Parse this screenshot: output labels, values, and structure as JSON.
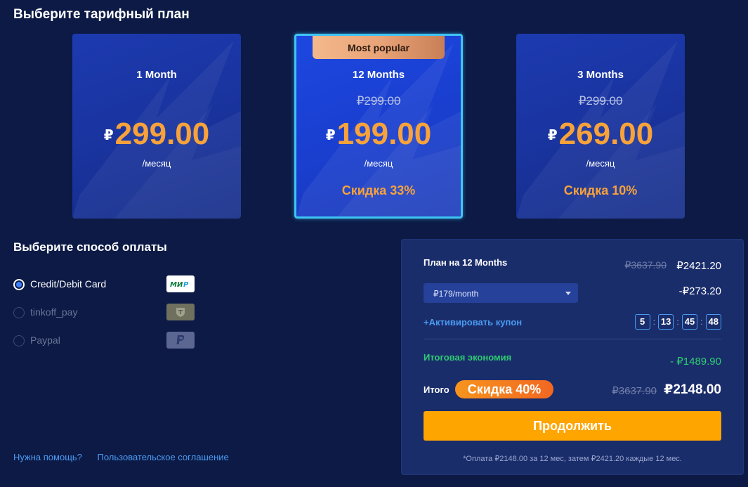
{
  "header": {
    "title": "Выберите тарифный план"
  },
  "plans": [
    {
      "name": "1 Month",
      "old_price": "",
      "currency": "₽",
      "price": "299.00",
      "per": "/месяц",
      "discount": ""
    },
    {
      "name": "12 Months",
      "badge": "Most popular",
      "old_price": "₽299.00",
      "currency": "₽",
      "price": "199.00",
      "per": "/месяц",
      "discount": "Скидка 33%"
    },
    {
      "name": "3 Months",
      "old_price": "₽299.00",
      "currency": "₽",
      "price": "269.00",
      "per": "/месяц",
      "discount": "Скидка 10%"
    }
  ],
  "payment": {
    "title": "Выберите способ оплаты",
    "methods": [
      {
        "label": "Credit/Debit Card",
        "logo": "мир",
        "selected": true
      },
      {
        "label": "tinkoff_pay",
        "selected": false
      },
      {
        "label": "Paypal",
        "selected": false
      }
    ]
  },
  "footer": {
    "help": "Нужна помощь?",
    "agreement": "Пользовательское соглашение"
  },
  "summary": {
    "plan": "План на 12 Months",
    "old_price": "₽3637.90",
    "price": "₽2421.20",
    "select_value": "₽179/month",
    "deduction": "-₽273.20",
    "coupon": "+Активировать купон",
    "timer": [
      "5",
      "13",
      "45",
      "48"
    ],
    "saving_label": "Итоговая экономия",
    "saving_value": "- ₽1489.90",
    "total_label": "Итого",
    "total_badge": "Скидка 40%",
    "total_old": "₽3637.90",
    "total": "₽2148.00",
    "continue": "Продолжить",
    "footnote": "*Оплата ₽2148.00 за 12 мес, затем ₽2421.20 каждые 12 мес."
  },
  "colors": {
    "background": "#0c1a45",
    "accent": "#f7a23b",
    "button": "#ffa500",
    "saving": "#2ecc71",
    "link": "#4a9bf2"
  }
}
